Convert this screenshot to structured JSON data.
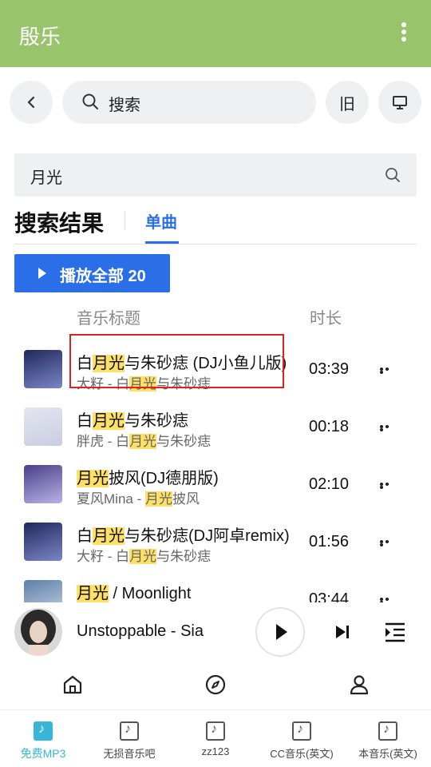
{
  "app": {
    "title": "殷乐"
  },
  "toolbar": {
    "search_label": "搜索",
    "old_label": "旧"
  },
  "query": {
    "value": "月光"
  },
  "results": {
    "title": "搜索结果",
    "tab_single": "单曲",
    "play_all": "播放全部 20",
    "col_title": "音乐标题",
    "col_duration": "时长"
  },
  "songs": [
    {
      "t_pre": "白",
      "t_hl": "月光",
      "t_post": "与朱砂痣 (DJ小鱼儿版)",
      "s_pre": "大籽 - 白",
      "s_hl": "月光",
      "s_post": "与朱砂痣",
      "dur": "03:39",
      "cover": [
        "#20285a",
        "#7a86c8"
      ]
    },
    {
      "t_pre": "白",
      "t_hl": "月光",
      "t_post": "与朱砂痣",
      "s_pre": "胖虎 - 白",
      "s_hl": "月光",
      "s_post": "与朱砂痣",
      "dur": "00:18",
      "cover": [
        "#e3e6ef",
        "#c9cde0"
      ]
    },
    {
      "t_pre": "",
      "t_hl": "月光",
      "t_post": "披风(DJ德朋版)",
      "s_pre": "夏风Mina - ",
      "s_hl": "月光",
      "s_post": "披风",
      "dur": "02:10",
      "cover": [
        "#4a3f88",
        "#b9b2e6"
      ]
    },
    {
      "t_pre": "白",
      "t_hl": "月光",
      "t_post": "与朱砂痣(DJ阿卓remix)",
      "s_pre": "大籽 - 白",
      "s_hl": "月光",
      "s_post": "与朱砂痣",
      "dur": "01:56",
      "cover": [
        "#20285a",
        "#7a86c8"
      ]
    },
    {
      "t_pre": "",
      "t_hl": "月光",
      "t_post": " / Moonlight",
      "s_pre": "",
      "s_hl": "",
      "s_post": "",
      "dur": "03:44",
      "cover": [
        "#5d7ea6",
        "#c7d6e8"
      ]
    }
  ],
  "player": {
    "song": "Unstoppable - Sia"
  },
  "bottom_nav": [
    {
      "label": "免费MP3",
      "active": true
    },
    {
      "label": "无损音乐吧",
      "active": false
    },
    {
      "label": "zz123",
      "active": false
    },
    {
      "label": "CC音乐(英文)",
      "active": false
    },
    {
      "label": "本音乐(英文)",
      "active": false
    }
  ]
}
